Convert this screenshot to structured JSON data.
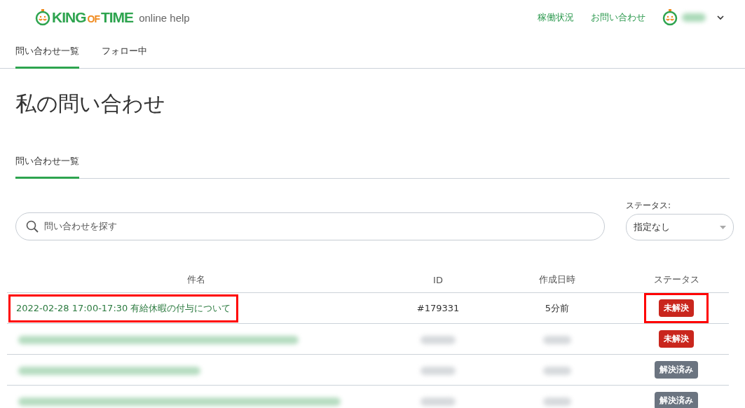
{
  "header": {
    "logo": {
      "part1": "KING",
      "part2": "OF",
      "part3": "TIME"
    },
    "product": "online help",
    "links": [
      "稼働状況",
      "お問い合わせ"
    ]
  },
  "nav_tabs": [
    {
      "label": "問い合わせ一覧",
      "selected": true
    },
    {
      "label": "フォロー中",
      "selected": false
    }
  ],
  "page_title": "私の問い合わせ",
  "sub_tabs": [
    {
      "label": "問い合わせ一覧",
      "selected": true
    }
  ],
  "search": {
    "placeholder": "問い合わせを探す"
  },
  "status_filter": {
    "label": "ステータス:",
    "value": "指定なし"
  },
  "table": {
    "columns": [
      "件名",
      "ID",
      "作成日時",
      "ステータス"
    ],
    "rows": [
      {
        "kind": "text",
        "subject": "2022-02-28 17:00-17:30 有給休暇の付与について",
        "id": "#179331",
        "created": "5分前",
        "status": "未解決",
        "resolved": false,
        "subject_highlighted": true,
        "status_highlighted": true
      },
      {
        "kind": "blurred",
        "status": "未解決",
        "resolved": false,
        "subject_highlighted": false,
        "status_highlighted": false
      },
      {
        "kind": "blurred",
        "status": "解決済み",
        "resolved": true,
        "subject_highlighted": false,
        "status_highlighted": false
      },
      {
        "kind": "blurred",
        "status": "解決済み",
        "resolved": true,
        "subject_highlighted": false,
        "status_highlighted": false
      }
    ]
  }
}
